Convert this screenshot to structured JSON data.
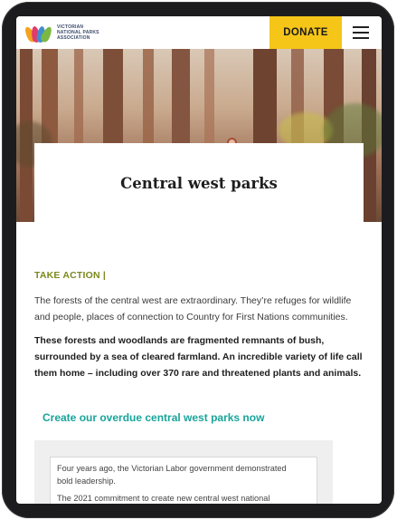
{
  "header": {
    "logo_lines": [
      "VICTORIAN",
      "NATIONAL PARKS",
      "ASSOCIATION"
    ],
    "donate_label": "DONATE",
    "menu_icon": "hamburger-menu-icon"
  },
  "hero": {
    "title": "Central west parks"
  },
  "content": {
    "section_label": "TAKE ACTION |",
    "paragraph1": "The forests of the central west are extraordinary. They’re refuges for wildlife and people, places of connection to Country for First Nations communities.",
    "paragraph2": "These forests and woodlands are fragmented remnants of bush, surrounded by a sea of cleared farmland. An incredible variety of life call them home – including over 370 rare and threatened plants and animals.",
    "cta_link": "Create our overdue central west parks now"
  },
  "letter": {
    "line1": "Four years ago, the Victorian Labor government demonstrated bold leadership.",
    "line2": "The 2021 commitment to create new central west national"
  },
  "colors": {
    "donate_bg": "#f5c518",
    "take_action": "#7b8a1b",
    "cta": "#18a49a"
  }
}
